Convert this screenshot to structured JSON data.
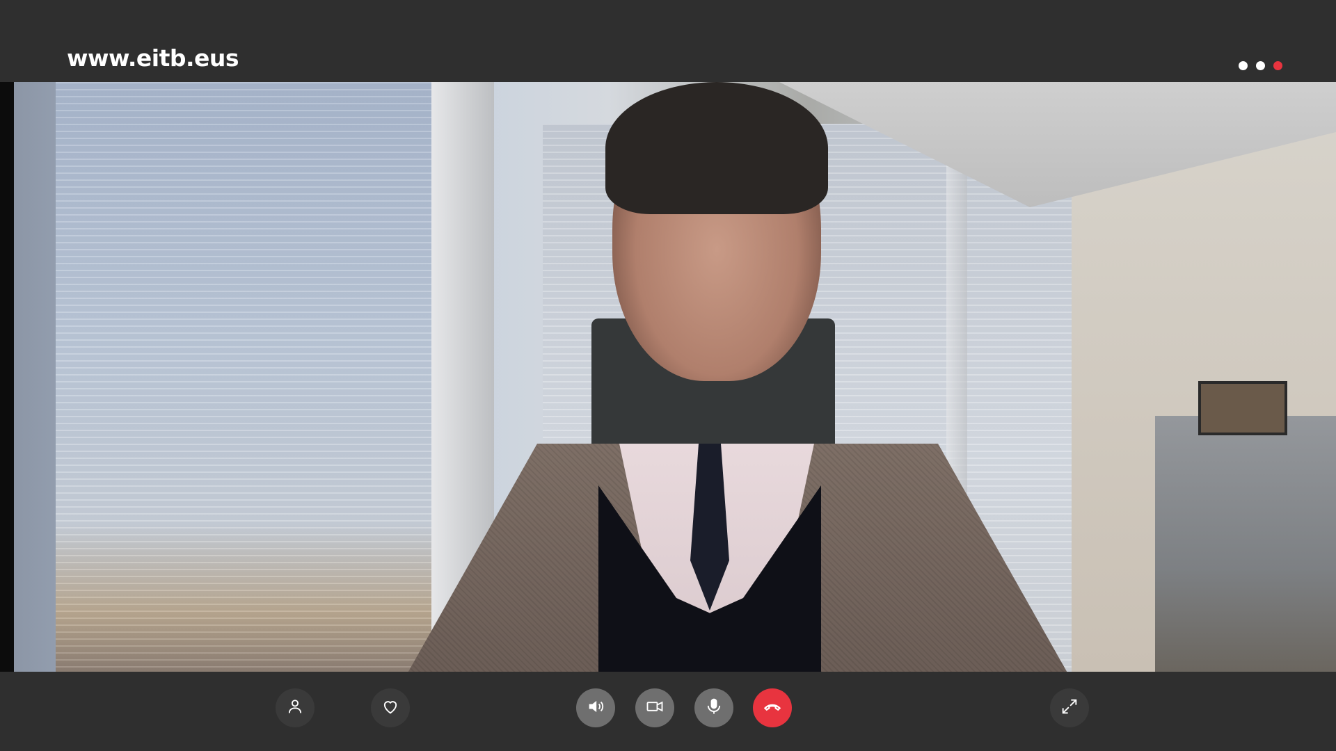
{
  "header": {
    "brand": "www.eitb.eus",
    "status_dots": [
      {
        "icon": "dot",
        "color": "#ffffff"
      },
      {
        "icon": "dot",
        "color": "#ffffff"
      },
      {
        "icon": "dot",
        "color": "#e8343f"
      }
    ]
  },
  "video": {
    "description_icon": "video-feed"
  },
  "controls": {
    "left": [
      {
        "icon": "profile-icon"
      },
      {
        "icon": "heart-icon"
      }
    ],
    "center": [
      {
        "icon": "speaker-icon"
      },
      {
        "icon": "camera-icon"
      },
      {
        "icon": "microphone-icon"
      },
      {
        "icon": "hangup-icon",
        "color": "#e8343f"
      }
    ],
    "right": [
      {
        "icon": "fullscreen-icon"
      }
    ]
  },
  "colors": {
    "background": "#2f2f2f",
    "accent": "#e8343f",
    "button": "#6f6f6f"
  }
}
